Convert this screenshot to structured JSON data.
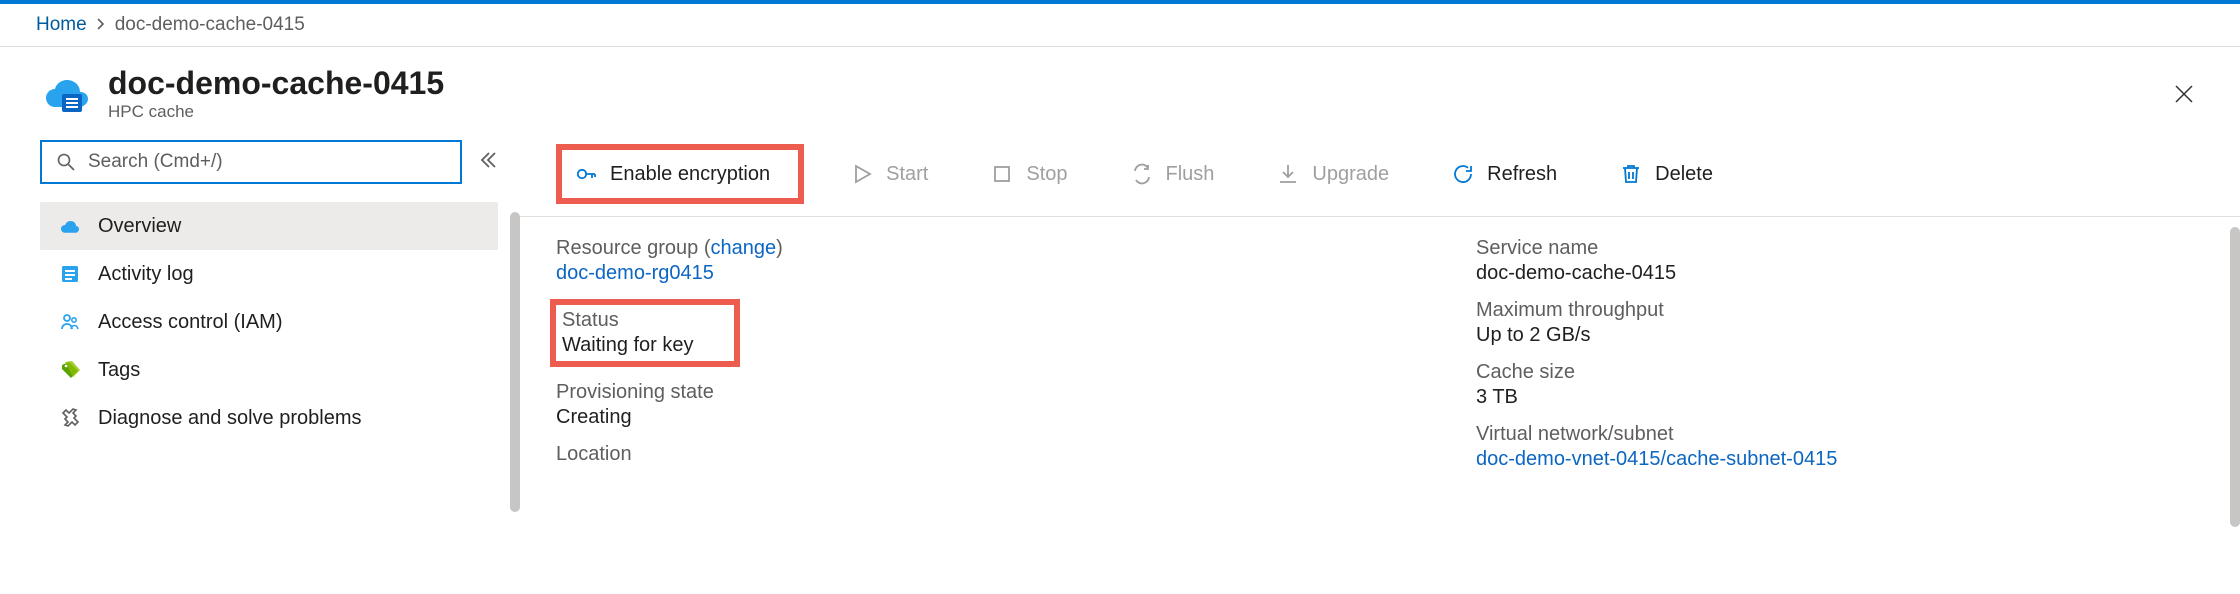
{
  "breadcrumb": {
    "home": "Home",
    "current": "doc-demo-cache-0415"
  },
  "header": {
    "title": "doc-demo-cache-0415",
    "subtitle": "HPC cache"
  },
  "search": {
    "placeholder": "Search (Cmd+/)"
  },
  "sidebar": {
    "items": [
      {
        "label": "Overview",
        "selected": true
      },
      {
        "label": "Activity log"
      },
      {
        "label": "Access control (IAM)"
      },
      {
        "label": "Tags"
      },
      {
        "label": "Diagnose and solve problems"
      }
    ]
  },
  "toolbar": {
    "enable_encryption": "Enable encryption",
    "start": "Start",
    "stop": "Stop",
    "flush": "Flush",
    "upgrade": "Upgrade",
    "refresh": "Refresh",
    "delete": "Delete"
  },
  "props": {
    "left": {
      "resource_group_label": "Resource group",
      "resource_group_change": "change",
      "resource_group_value": "doc-demo-rg0415",
      "status_label": "Status",
      "status_value": "Waiting for key",
      "provisioning_label": "Provisioning state",
      "provisioning_value": "Creating",
      "location_label": "Location"
    },
    "right": {
      "service_name_label": "Service name",
      "service_name_value": "doc-demo-cache-0415",
      "throughput_label": "Maximum throughput",
      "throughput_value": "Up to 2 GB/s",
      "cache_size_label": "Cache size",
      "cache_size_value": "3 TB",
      "vnet_label": "Virtual network/subnet",
      "vnet_value": "doc-demo-vnet-0415/cache-subnet-0415"
    }
  }
}
